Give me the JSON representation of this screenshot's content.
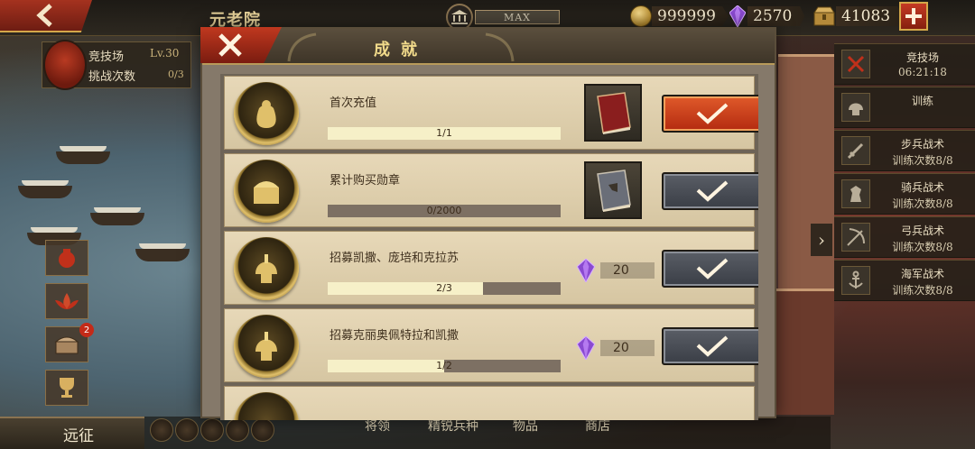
{
  "top_bar": {
    "title": "元老院",
    "level_status": "MAX",
    "resources": [
      {
        "icon": "gold-coin-icon",
        "value": "999999"
      },
      {
        "icon": "purple-gem-icon",
        "value": "2570"
      },
      {
        "icon": "supply-chest-icon",
        "value": "41083"
      }
    ]
  },
  "arena": {
    "name": "竞技场",
    "level": "Lv.30",
    "challenge_label": "挑战次数",
    "challenge_count": "0/3"
  },
  "left_buttons": [
    {
      "icon": "loot-bag-icon"
    },
    {
      "icon": "lotus-icon"
    },
    {
      "icon": "treasure-chest-icon",
      "badge": "2"
    },
    {
      "icon": "trophy-icon"
    }
  ],
  "expedition_label": "远征",
  "modal": {
    "title": "成就",
    "achievements": [
      {
        "title": "首次充值",
        "progress_text": "1/1",
        "progress": 1.0,
        "reward_type": "book",
        "reward_icon": "red-tome-icon",
        "reward_value": "",
        "state": "claimable"
      },
      {
        "title": "累计购买勋章",
        "progress_text": "0/2000",
        "progress": 0.0,
        "reward_type": "book",
        "reward_icon": "blue-tome-icon",
        "reward_value": "",
        "state": "locked"
      },
      {
        "title": "招募凯撒、庞培和克拉苏",
        "progress_text": "2/3",
        "progress": 0.667,
        "reward_type": "gem",
        "reward_icon": "purple-gem-icon",
        "reward_value": "20",
        "state": "locked"
      },
      {
        "title": "招募克丽奥佩特拉和凯撒",
        "progress_text": "1/2",
        "progress": 0.5,
        "reward_type": "gem",
        "reward_icon": "purple-gem-icon",
        "reward_value": "20",
        "state": "locked"
      }
    ]
  },
  "right_sidebar": [
    {
      "icon": "crossed-swords-icon",
      "line1": "竞技场",
      "line2": "06:21:18"
    },
    {
      "icon": "helmet-icon",
      "line1": "训练",
      "line2": ""
    },
    {
      "icon": "sword-icon",
      "line1": "步兵战术",
      "line2": "训练次数8/8"
    },
    {
      "icon": "horse-icon",
      "line1": "骑兵战术",
      "line2": "训练次数8/8"
    },
    {
      "icon": "bow-icon",
      "line1": "弓兵战术",
      "line2": "训练次数8/8"
    },
    {
      "icon": "anchor-icon",
      "line1": "海军战术",
      "line2": "训练次数8/8"
    }
  ],
  "bottom_nav": [
    "将领",
    "精锐兵种",
    "物品",
    "商店"
  ],
  "colors": {
    "claim_active": "#d04a20",
    "claim_locked": "#4a4e56",
    "progress_fill": "#f6f0c8",
    "gold_text": "#f0d98a"
  }
}
